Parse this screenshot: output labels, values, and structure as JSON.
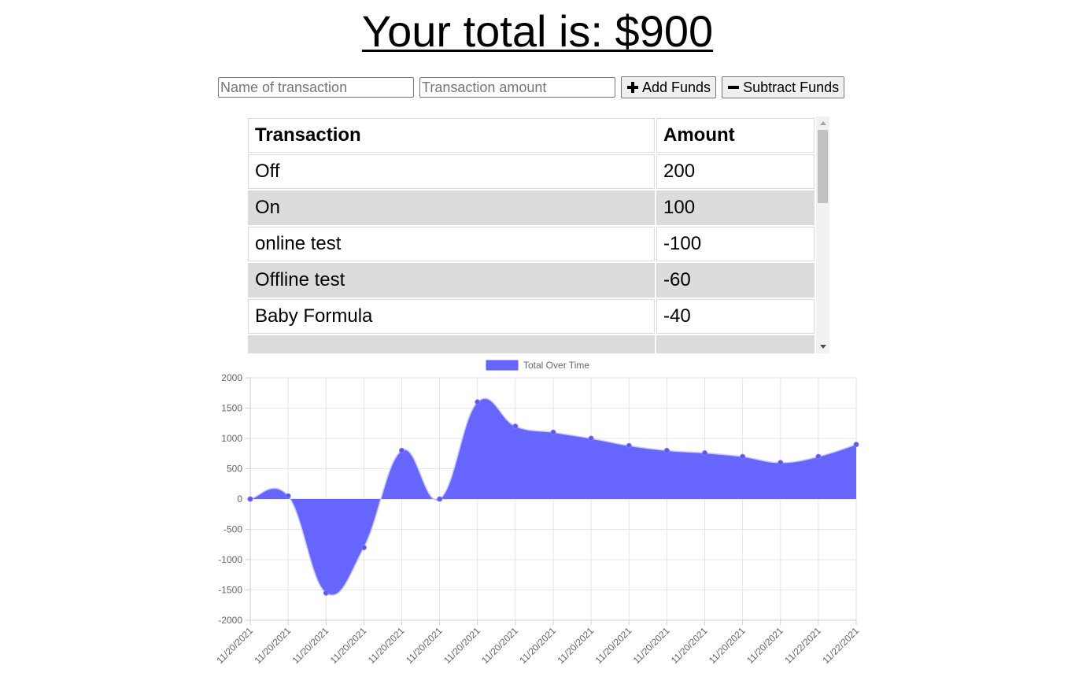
{
  "header": {
    "title": "Your total is: $900"
  },
  "form": {
    "name_placeholder": "Name of transaction",
    "amount_placeholder": "Transaction amount",
    "add_label": "Add Funds",
    "subtract_label": "Subtract Funds"
  },
  "table": {
    "headers": [
      "Transaction",
      "Amount"
    ],
    "rows": [
      {
        "name": "Off",
        "amount": "200"
      },
      {
        "name": "On",
        "amount": "100"
      },
      {
        "name": "online test",
        "amount": "-100"
      },
      {
        "name": "Offline test",
        "amount": "-60"
      },
      {
        "name": "Baby Formula",
        "amount": "-40"
      }
    ]
  },
  "chart_data": {
    "type": "line",
    "fill": true,
    "legend": "top",
    "grid": true,
    "color": "#6666ff",
    "series": [
      {
        "name": "Total Over Time",
        "values": [
          0,
          50,
          -1550,
          -800,
          800,
          0,
          1600,
          1200,
          1100,
          1000,
          880,
          800,
          760,
          700,
          600,
          700,
          900
        ]
      }
    ],
    "categories": [
      "11/20/2021",
      "11/20/2021",
      "11/20/2021",
      "11/20/2021",
      "11/20/2021",
      "11/20/2021",
      "11/20/2021",
      "11/20/2021",
      "11/20/2021",
      "11/20/2021",
      "11/20/2021",
      "11/20/2021",
      "11/20/2021",
      "11/20/2021",
      "11/20/2021",
      "11/22/2021",
      "11/22/2021"
    ],
    "ylim": [
      -2000,
      2000
    ],
    "yticks": [
      2000,
      1500,
      1000,
      500,
      0,
      -500,
      -1000,
      -1500,
      -2000
    ]
  }
}
